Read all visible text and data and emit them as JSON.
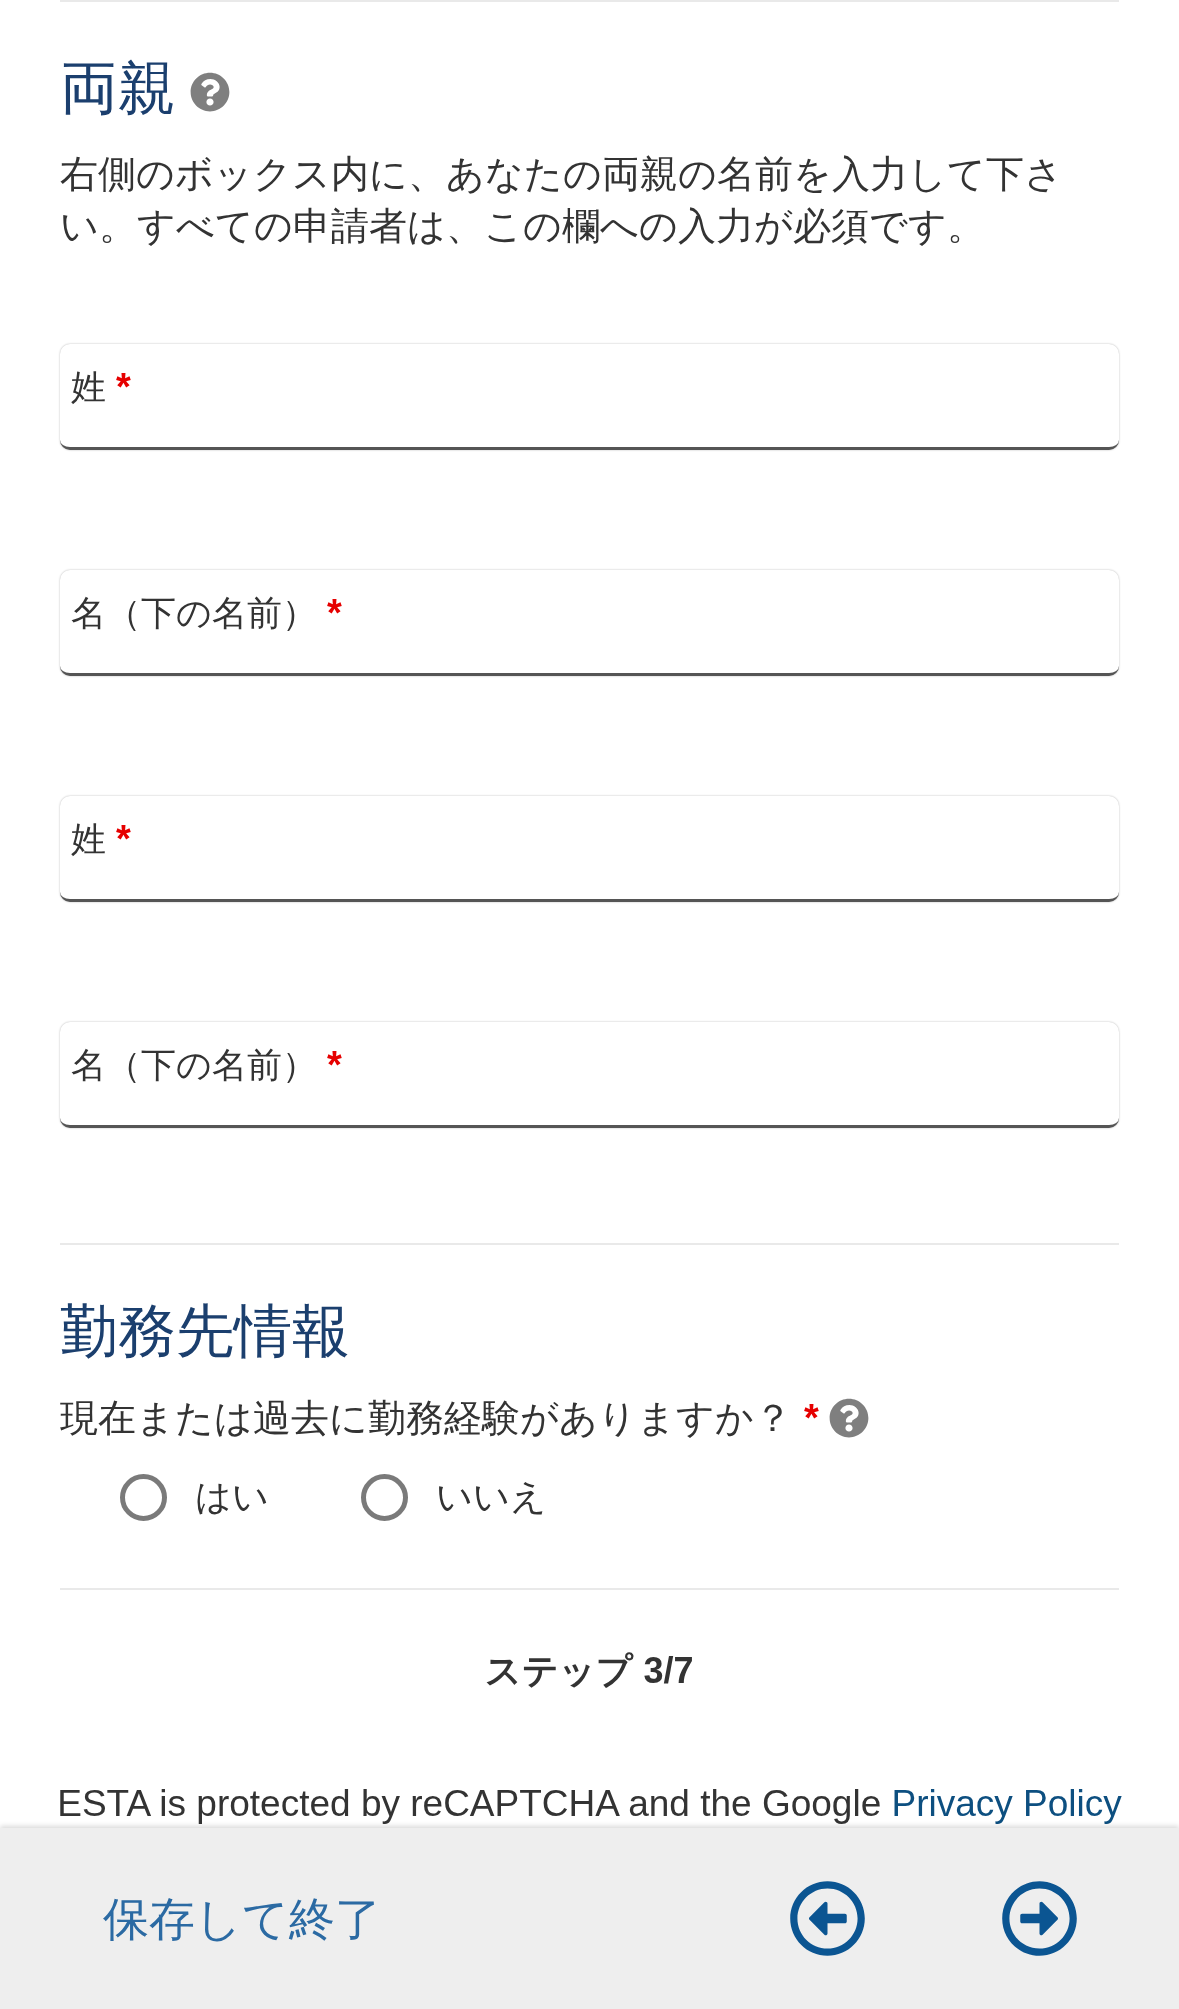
{
  "parents_section": {
    "heading": "両親",
    "instructions": "右側のボックス内に、あなたの両親の名前を入力して下さい。すべての申請者は、この欄への入力が必須です。",
    "fields": [
      {
        "label": "姓",
        "required_mark": "*"
      },
      {
        "label": "名（下の名前）",
        "required_mark": "*"
      },
      {
        "label": "姓",
        "required_mark": "*"
      },
      {
        "label": "名（下の名前）",
        "required_mark": "*"
      }
    ]
  },
  "employment_section": {
    "heading": "勤務先情報",
    "question": "現在または過去に勤務経験がありますか？",
    "required_mark": "*",
    "options": [
      {
        "label": "はい",
        "selected": false
      },
      {
        "label": "いいえ",
        "selected": false
      }
    ]
  },
  "step": "ステップ 3/7",
  "recaptcha_notice": {
    "text": "ESTA is protected by reCAPTCHA and the Google",
    "link": "Privacy Policy"
  },
  "footer": {
    "save_link": "保存して終了"
  }
}
